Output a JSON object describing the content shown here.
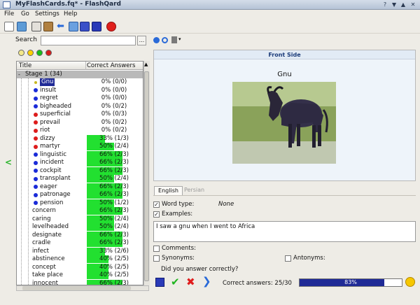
{
  "window": {
    "title": "MyFlashCards.fq* - FlashQard",
    "buttons": [
      "?",
      "▲",
      "▲",
      "✕"
    ]
  },
  "menu": [
    "File",
    "Go",
    "Settings",
    "Help"
  ],
  "search": {
    "label": "Search",
    "value": "",
    "more": "..."
  },
  "stage_colors": [
    "#f3e88a",
    "#ffd000",
    "#18c018",
    "#d81c1c"
  ],
  "tree": {
    "columns": [
      "Title",
      "Correct Answers"
    ],
    "stage": {
      "toggle": "-",
      "label": "Stage 1",
      "count": "(34)"
    },
    "rows": [
      {
        "word": "Gnu",
        "score": "0% (0/0)",
        "pct": 0,
        "color": "#c8b820",
        "selected": true
      },
      {
        "word": "insult",
        "score": "0% (0/0)",
        "pct": 0,
        "color": "#1a2bd8"
      },
      {
        "word": "regret",
        "score": "0% (0/0)",
        "pct": 0,
        "color": "#1a2bd8"
      },
      {
        "word": "bigheaded",
        "score": "0% (0/2)",
        "pct": 0,
        "color": "#1a2bd8"
      },
      {
        "word": "superficial",
        "score": "0% (0/3)",
        "pct": 0,
        "color": "#dd1c1c"
      },
      {
        "word": "prevail",
        "score": "0% (0/2)",
        "pct": 0,
        "color": "#dd1c1c"
      },
      {
        "word": "riot",
        "score": "0% (0/2)",
        "pct": 0,
        "color": "#dd1c1c"
      },
      {
        "word": "dizzy",
        "score": "33% (1/3)",
        "pct": 33,
        "color": "#dd1c1c"
      },
      {
        "word": "martyr",
        "score": "50% (2/4)",
        "pct": 50,
        "color": "#dd1c1c"
      },
      {
        "word": "linguistic",
        "score": "66% (2/3)",
        "pct": 66,
        "color": "#1a2bd8"
      },
      {
        "word": "incident",
        "score": "66% (2/3)",
        "pct": 66,
        "color": "#1a2bd8"
      },
      {
        "word": "cockpit",
        "score": "66% (2/3)",
        "pct": 66,
        "color": "#1a2bd8"
      },
      {
        "word": "transplant",
        "score": "50% (2/4)",
        "pct": 50,
        "color": "#1a2bd8"
      },
      {
        "word": "eager",
        "score": "66% (2/3)",
        "pct": 66,
        "color": "#1a2bd8"
      },
      {
        "word": "patronage",
        "score": "66% (2/3)",
        "pct": 66,
        "color": "#1a2bd8"
      },
      {
        "word": "pension",
        "score": "50% (1/2)",
        "pct": 50,
        "color": "#1a2bd8"
      },
      {
        "word": "concern",
        "score": "66% (2/3)",
        "pct": 66,
        "color": ""
      },
      {
        "word": "caring",
        "score": "50% (2/4)",
        "pct": 50,
        "color": ""
      },
      {
        "word": "levelheaded",
        "score": "50% (2/4)",
        "pct": 50,
        "color": ""
      },
      {
        "word": "designate",
        "score": "66% (2/3)",
        "pct": 66,
        "color": ""
      },
      {
        "word": "cradle",
        "score": "66% (2/3)",
        "pct": 66,
        "color": ""
      },
      {
        "word": "infect",
        "score": "33% (2/6)",
        "pct": 33,
        "color": ""
      },
      {
        "word": "abstinence",
        "score": "40% (2/5)",
        "pct": 40,
        "color": ""
      },
      {
        "word": "concept",
        "score": "40% (2/5)",
        "pct": 40,
        "color": ""
      },
      {
        "word": "take place",
        "score": "40% (2/5)",
        "pct": 40,
        "color": ""
      },
      {
        "word": "innocent",
        "score": "66% (2/3)",
        "pct": 66,
        "color": ""
      }
    ]
  },
  "card": {
    "side_label": "Front Side",
    "word": "Gnu",
    "tabs": [
      "English",
      "Persian"
    ],
    "word_type_label": "Word type:",
    "word_type_value": "None",
    "examples_label": "Examples:",
    "examples_text": "I saw a gnu when I went to Africa",
    "comments_label": "Comments:",
    "synonyms_label": "Synonyms:",
    "antonyms_label": "Antonyms:",
    "question": "Did you answer correctly?",
    "correct_label": "Correct answers: 25/30",
    "progress_pct": 83,
    "progress_text": "83%"
  }
}
